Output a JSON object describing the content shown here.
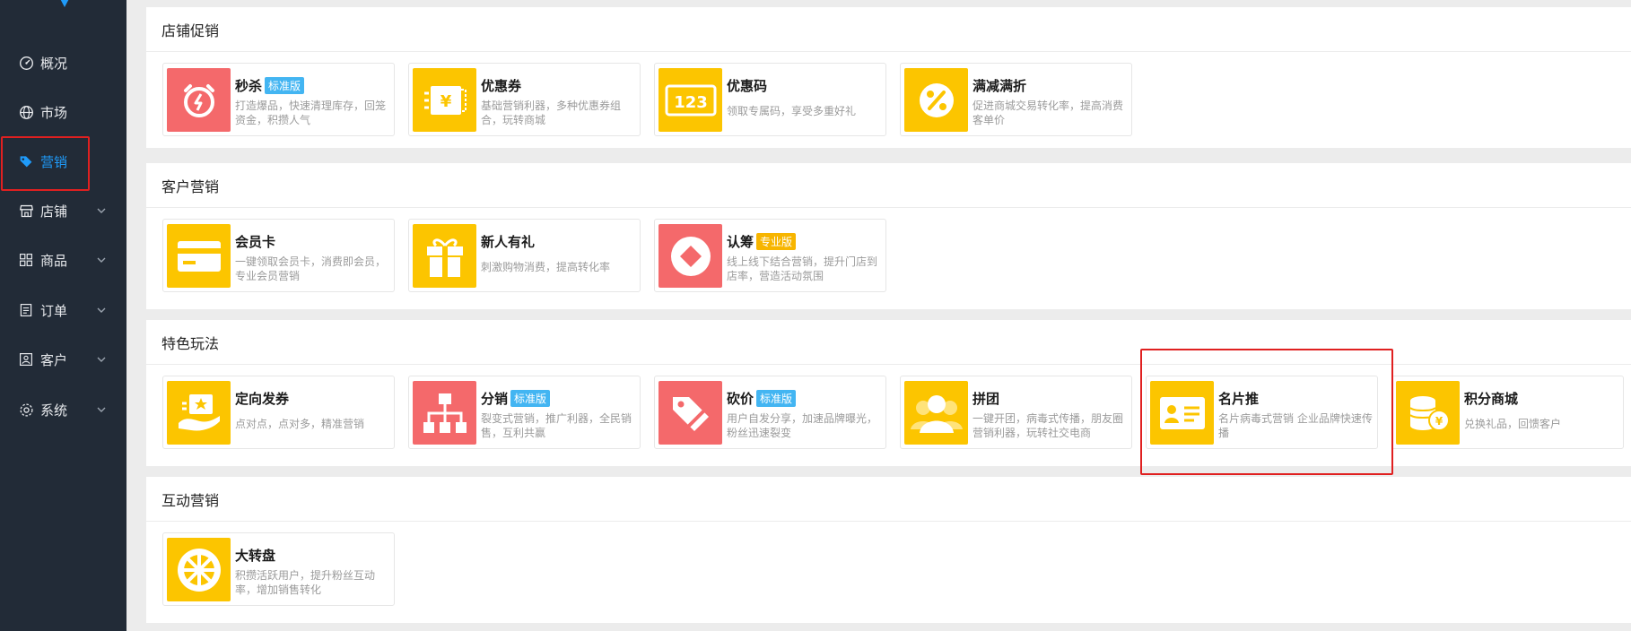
{
  "sidebar": {
    "items": [
      {
        "label": "概况",
        "icon": "gauge-icon",
        "has_children": false
      },
      {
        "label": "市场",
        "icon": "globe-icon",
        "has_children": false
      },
      {
        "label": "营销",
        "icon": "tag-icon",
        "has_children": false,
        "active": true
      },
      {
        "label": "店铺",
        "icon": "store-icon",
        "has_children": true
      },
      {
        "label": "商品",
        "icon": "grid-icon",
        "has_children": true
      },
      {
        "label": "订单",
        "icon": "list-icon",
        "has_children": true
      },
      {
        "label": "客户",
        "icon": "user-card-icon",
        "has_children": true
      },
      {
        "label": "系统",
        "icon": "gear-icon",
        "has_children": true
      }
    ]
  },
  "sections": [
    {
      "title": "店铺促销",
      "cards": [
        {
          "title": "秒杀",
          "badge": "标准版",
          "desc": "打造爆品，快速清理库存，回笼资金，积攒人气",
          "icon": "alarm-clock-icon",
          "color": "red"
        },
        {
          "title": "优惠券",
          "desc": "基础营销利器，多种优惠券组合，玩转商城",
          "icon": "coupon-icon",
          "color": "yellow"
        },
        {
          "title": "优惠码",
          "desc": "领取专属码，享受多重好礼",
          "icon": "code-123-icon",
          "color": "yellow"
        },
        {
          "title": "满减满折",
          "desc": "促进商城交易转化率，提高消费客单价",
          "icon": "percent-icon",
          "color": "yellow"
        }
      ]
    },
    {
      "title": "客户营销",
      "cards": [
        {
          "title": "会员卡",
          "desc": "一键领取会员卡，消费即会员，专业会员营销",
          "icon": "card-icon",
          "color": "yellow"
        },
        {
          "title": "新人有礼",
          "desc": "刺激购物消费，提高转化率",
          "icon": "gift-icon",
          "color": "yellow"
        },
        {
          "title": "认筹",
          "badge": "专业版",
          "desc": "线上线下结合营销，提升门店到店率，营造活动氛围",
          "icon": "diamond-icon",
          "color": "red"
        }
      ]
    },
    {
      "title": "特色玩法",
      "cards": [
        {
          "title": "定向发券",
          "desc": "点对点，点对多，精准营销",
          "icon": "hand-coupon-icon",
          "color": "yellow"
        },
        {
          "title": "分销",
          "badge": "标准版",
          "desc": "裂变式营销，推广利器，全民销售，互利共赢",
          "icon": "hierarchy-icon",
          "color": "red"
        },
        {
          "title": "砍价",
          "badge": "标准版",
          "desc": "用户自发分享，加速品牌曝光，粉丝迅速裂变",
          "icon": "price-tag-cut-icon",
          "color": "red"
        },
        {
          "title": "拼团",
          "desc": "一键开团，病毒式传播，朋友圈营销利器，玩转社交电商",
          "icon": "group-users-icon",
          "color": "yellow"
        },
        {
          "title": "名片推",
          "desc": "名片病毒式营销 企业品牌快速传播",
          "icon": "business-card-icon",
          "color": "yellow"
        },
        {
          "title": "积分商城",
          "desc": "兑换礼品，回馈客户",
          "icon": "coins-icon",
          "color": "yellow"
        }
      ]
    },
    {
      "title": "互动营销",
      "cards": [
        {
          "title": "大转盘",
          "desc": "积攒活跃用户，提升粉丝互动率，增加销售转化",
          "icon": "wheel-icon",
          "color": "yellow"
        }
      ]
    }
  ],
  "colors": {
    "sidebar_bg": "#222b37",
    "active": "#1f9bfa",
    "highlight": "#e02020",
    "yellow": "#fcc500",
    "red": "#f4696b"
  }
}
